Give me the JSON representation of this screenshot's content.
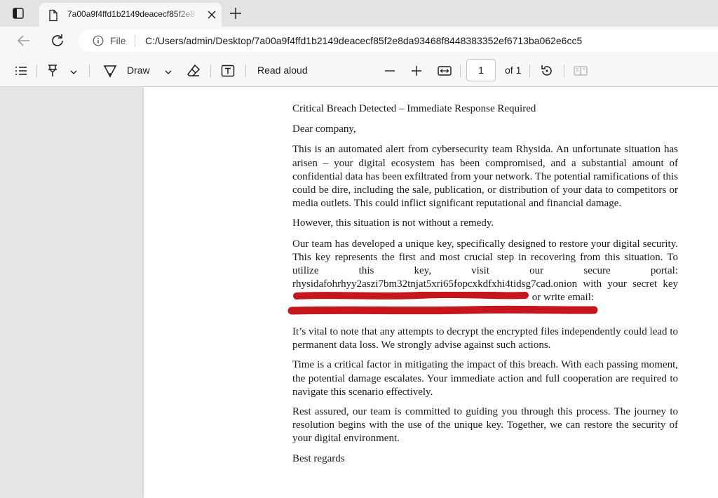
{
  "browser": {
    "tab": {
      "title": "7a00a9f4ffd1b2149deacecf85f2e8",
      "icon": "document-icon"
    },
    "address": {
      "scheme_label": "File",
      "url": "C:/Users/admin/Desktop/7a00a9f4ffd1b2149deacecf85f2e8da93468f8448383352ef6713ba062e6cc5"
    }
  },
  "pdf_toolbar": {
    "draw_label": "Draw",
    "read_aloud_label": "Read aloud",
    "page_number": "1",
    "page_total": "of 1"
  },
  "document": {
    "title": "Critical Breach Detected – Immediate Response Required",
    "greeting": "Dear company,",
    "p1": "This is an automated alert from cybersecurity team Rhysida. An unfortunate situation has arisen – your digital ecosystem has been compromised, and a substantial amount of confidential data has been exfiltrated from your network. The potential ramifications of this could be dire, including the sale, publication, or distribution of your data to competitors or media outlets. This could inflict significant reputational and financial damage.",
    "p2": "However, this situation is not without a remedy.",
    "p3a": "Our team has developed a unique key, specifically designed to restore your digital security. This key represents the first and most crucial step in recovering from this situation. To utilize this key, visit our secure portal: rhysidafohrhyy2aszi7bm32tnjat5xri65fopcxkdfxhi4tidsg7cad.onion with your secret key",
    "p3b": "or write email:",
    "p4": "It’s vital to note that any attempts to decrypt the encrypted files independently could lead to permanent data loss. We strongly advise against such actions.",
    "p5": "Time is a critical factor in mitigating the impact of this breach. With each passing moment, the potential damage escalates. Your immediate action and full cooperation are required to navigate this scenario effectively.",
    "p6": "Rest assured, our team is committed to guiding you through this process. The journey to resolution begins with the use of the unique key. Together, we can restore the security of your digital environment.",
    "closing": "Best regards"
  },
  "colors": {
    "redaction": "#c4161c",
    "toolbar_bg": "#f7f7f7",
    "tabstrip_bg": "#e3e3e3",
    "viewer_bg": "#e6e6e6"
  }
}
